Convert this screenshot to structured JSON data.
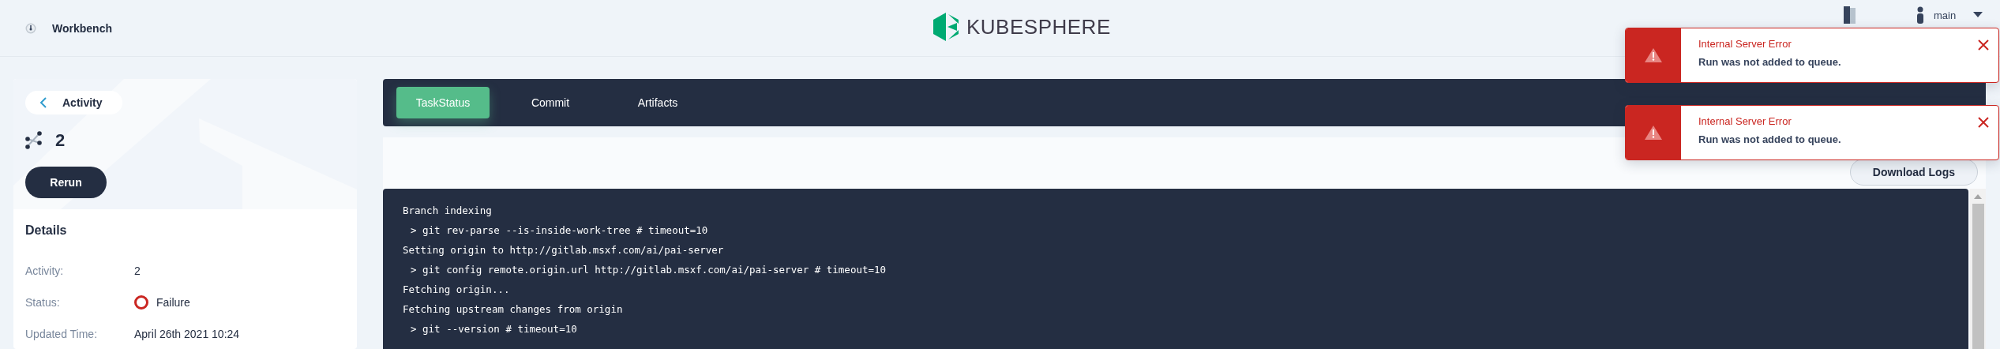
{
  "header": {
    "title": "Workbench",
    "logo": "KUBESPHERE",
    "user": "main"
  },
  "activity_card": {
    "back_label": "Activity",
    "run_number": "2",
    "button": "Rerun"
  },
  "details": {
    "title": "Details",
    "rows": [
      {
        "label": "Activity:",
        "value": "2",
        "kind": "text"
      },
      {
        "label": "Status:",
        "value": "Failure",
        "kind": "status"
      },
      {
        "label": "Updated Time:",
        "value": "April 26th 2021 10:24",
        "kind": "text"
      }
    ]
  },
  "tabs": [
    {
      "label": "TaskStatus",
      "selected": true
    },
    {
      "label": "Commit",
      "selected": false
    },
    {
      "label": "Artifacts",
      "selected": false
    }
  ],
  "download_button": "Download Logs",
  "log_lines": [
    {
      "text": "Branch indexing",
      "kind": "message"
    },
    {
      "text": "> git rev-parse --is-inside-work-tree # timeout=10",
      "kind": "command"
    },
    {
      "text": "Setting origin to http://gitlab.msxf.com/ai/pai-server",
      "kind": "message"
    },
    {
      "text": "> git config remote.origin.url http://gitlab.msxf.com/ai/pai-server # timeout=10",
      "kind": "command"
    },
    {
      "text": "Fetching origin...",
      "kind": "message"
    },
    {
      "text": "Fetching upstream changes from origin",
      "kind": "message"
    },
    {
      "text": "> git --version # timeout=10",
      "kind": "command"
    }
  ],
  "notifications": [
    {
      "title": "Internal Server Error",
      "message": "Run was not added to queue."
    },
    {
      "title": "Internal Server Error",
      "message": "Run was not added to queue."
    }
  ]
}
